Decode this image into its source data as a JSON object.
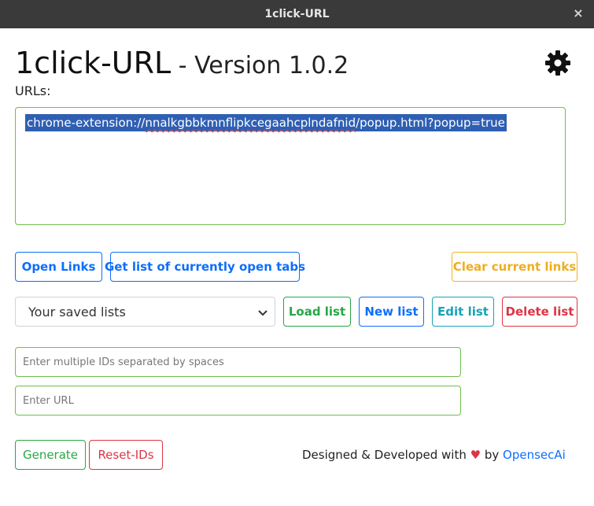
{
  "window": {
    "title": "1click-URL",
    "close_glyph": "×"
  },
  "header": {
    "app_name": "1click-URL",
    "version": " - Version 1.0.2",
    "settings_icon": "gear-icon"
  },
  "urls": {
    "label": "URLs:",
    "prefix": "chrome-extension://",
    "ext_id": "nnalkgbbkmnflipkcegaahcplndafnid",
    "suffix": "/popup.html?popup=true"
  },
  "buttons": {
    "open_links": "Open Links",
    "get_tabs": "Get list of currently open tabs",
    "clear_links": "Clear current links",
    "load_list": "Load list",
    "new_list": "New list",
    "edit_list": "Edit list",
    "delete_list": "Delete list",
    "generate": "Generate",
    "reset_ids": "Reset-IDs"
  },
  "saved_lists": {
    "selected": "Your saved lists"
  },
  "inputs": {
    "ids_placeholder": "Enter multiple IDs separated by spaces",
    "url_placeholder": "Enter URL"
  },
  "footer": {
    "text_before": "Designed & Developed with ",
    "heart": "♥",
    "text_by": " by ",
    "author": "OpensecAi"
  },
  "colors": {
    "primary": "#0d6efd",
    "success": "#28a745",
    "warning": "#f0ad1c",
    "info": "#17a2b8",
    "danger": "#dc3545",
    "input_border": "#6cc04a",
    "titlebar": "#3a3a3a"
  }
}
